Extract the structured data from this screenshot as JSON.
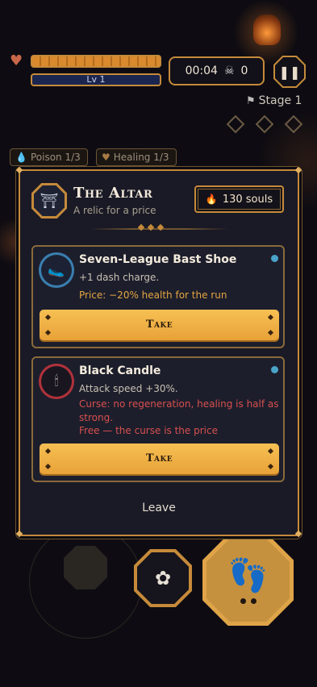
{
  "hud": {
    "level_label": "Lv 1",
    "timer": "00:04",
    "kills": "0",
    "pause_icon": "pause-icon",
    "stage_label": "Stage 1"
  },
  "status_effects": [
    {
      "label": "Poison 1/3",
      "icon": "poison-drop-icon"
    },
    {
      "label": "Healing 1/3",
      "icon": "healing-heart-icon"
    }
  ],
  "modal": {
    "title": "The Altar",
    "subtitle": "A relic for a price",
    "souls": "130 souls",
    "leave_label": "Leave",
    "offers": [
      {
        "name": "Seven-League Bast Shoe",
        "description": "+1 dash charge.",
        "curse": "",
        "price": "Price: −20% health for the run",
        "price_color": "#e3a642",
        "button": "Take"
      },
      {
        "name": "Black Candle",
        "description": "Attack speed +30%.",
        "curse": "Curse: no regeneration, healing is half as strong.",
        "price": "Free — the curse is the price",
        "price_color": "#d8504e",
        "button": "Take"
      }
    ]
  },
  "colors": {
    "accent_gold": "#c58a3a",
    "button_gold": "#f6c053",
    "panel_bg": "#1a1a26",
    "curse_red": "#d8504e"
  }
}
